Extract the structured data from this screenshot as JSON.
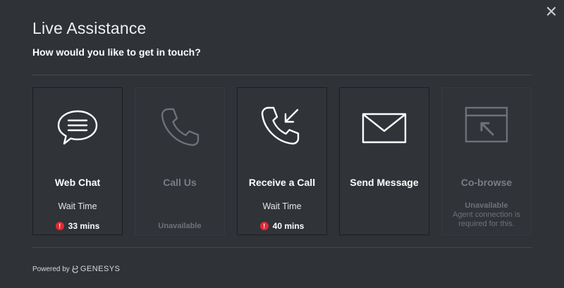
{
  "header": {
    "title": "Live Assistance",
    "subtitle": "How would you like to get in touch?"
  },
  "colors": {
    "background": "#2f3237",
    "alert": "#e02a33",
    "disabled_text": "#6e7278"
  },
  "cards": [
    {
      "label": "Web Chat",
      "icon": "chat-bubble-icon",
      "enabled": true,
      "wait_label": "Wait Time",
      "wait_time": "33 mins"
    },
    {
      "label": "Call Us",
      "icon": "phone-icon",
      "enabled": false,
      "status": "Unavailable"
    },
    {
      "label": "Receive a Call",
      "icon": "incoming-call-icon",
      "enabled": true,
      "wait_label": "Wait Time",
      "wait_time": "40 mins"
    },
    {
      "label": "Send Message",
      "icon": "envelope-icon",
      "enabled": true
    },
    {
      "label": "Co-browse",
      "icon": "cobrowse-icon",
      "enabled": false,
      "status": "Unavailable",
      "status_note": "Agent connection is required for this."
    }
  ],
  "footer": {
    "powered_by": "Powered by",
    "brand": "GENESYS"
  }
}
